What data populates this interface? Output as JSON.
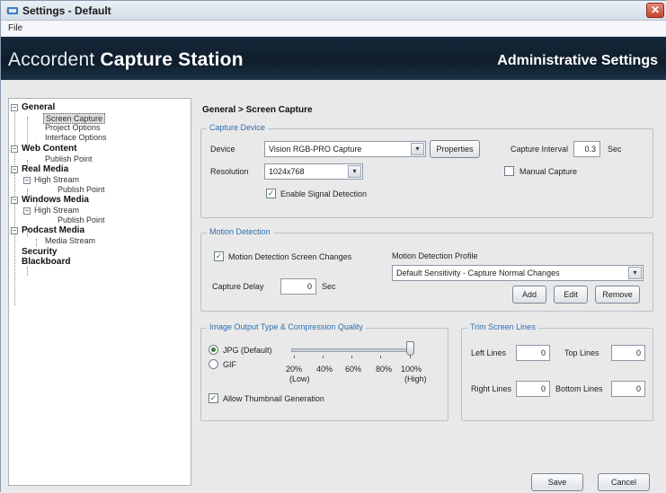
{
  "window": {
    "title": "Settings - Default",
    "close_glyph": "✕"
  },
  "menu": {
    "file": "File"
  },
  "banner": {
    "app_light": "Accordent ",
    "app_bold": "Capture Station",
    "admin": "Administrative Settings"
  },
  "tree": {
    "general": "General",
    "screen_capture": "Screen Capture",
    "project_options": "Project Options",
    "interface_options": "Interface Options",
    "web_content": "Web Content",
    "publish_point_1": "Publish Point",
    "real_media": "Real Media",
    "high_stream_1": "High Stream",
    "publish_point_2": "Publish Point",
    "windows_media": "Windows Media",
    "high_stream_2": "High Stream",
    "publish_point_3": "Publish Point",
    "podcast_media": "Podcast Media",
    "media_stream": "Media Stream",
    "security": "Security",
    "blackboard": "Blackboard"
  },
  "breadcrumb": "General > Screen Capture",
  "capture_device": {
    "legend": "Capture Device",
    "device_label": "Device",
    "device_value": "Vision RGB-PRO Capture",
    "properties": "Properties",
    "interval_label": "Capture Interval",
    "interval_value": "0.3",
    "interval_unit": "Sec",
    "resolution_label": "Resolution",
    "resolution_value": "1024x768",
    "manual_capture": "Manual Capture",
    "manual_checked": false,
    "signal_detection": "Enable Signal Detection",
    "signal_checked": true
  },
  "motion": {
    "legend": "Motion Detection",
    "screen_changes": "Motion Detection Screen Changes",
    "screen_changes_checked": true,
    "profile_label": "Motion Detection Profile",
    "profile_value": "Default Sensitivity - Capture Normal Changes",
    "delay_label": "Capture Delay",
    "delay_value": "0",
    "delay_unit": "Sec",
    "add": "Add",
    "edit": "Edit",
    "remove": "Remove"
  },
  "image": {
    "legend": "Image Output Type & Compression Quality",
    "jpg": "JPG (Default)",
    "gif": "GIF",
    "selected": "JPG",
    "quality_percent": 100,
    "ticks": [
      "20%",
      "40%",
      "60%",
      "80%",
      "100%"
    ],
    "low": "(Low)",
    "high": "(High)",
    "thumbnail": "Allow Thumbnail Generation",
    "thumbnail_checked": true
  },
  "trim": {
    "legend": "Trim Screen Lines",
    "left_label": "Left Lines",
    "left_value": "0",
    "top_label": "Top Lines",
    "top_value": "0",
    "right_label": "Right Lines",
    "right_value": "0",
    "bottom_label": "Bottom Lines",
    "bottom_value": "0"
  },
  "footer": {
    "save": "Save",
    "cancel": "Cancel"
  },
  "colors": {
    "banner": "#16283a",
    "legend": "#2f6fb0",
    "close": "#c64530"
  }
}
